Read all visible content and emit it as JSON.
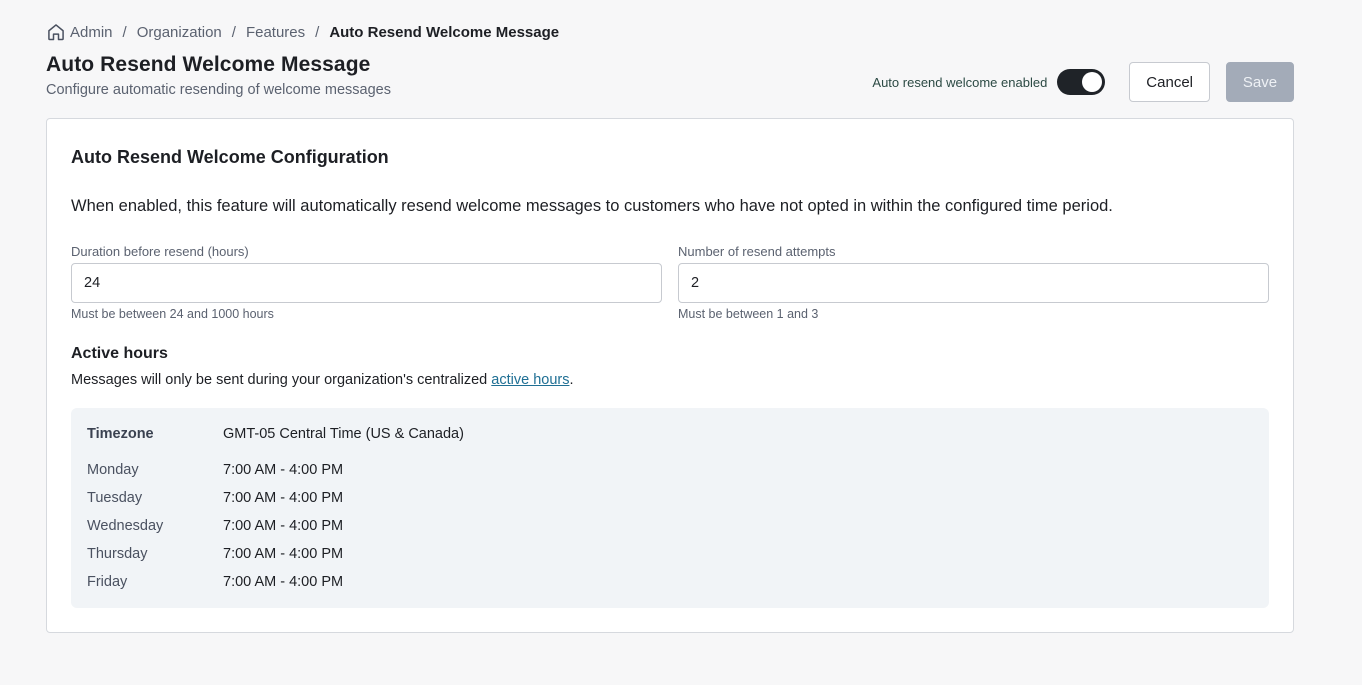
{
  "breadcrumb": {
    "items": [
      "Admin",
      "Organization",
      "Features",
      "Auto Resend Welcome Message"
    ],
    "separator": "/"
  },
  "page": {
    "title": "Auto Resend Welcome Message",
    "subtitle": "Configure automatic resending of welcome messages"
  },
  "header_actions": {
    "toggle_label": "Auto resend welcome enabled",
    "toggle_on": true,
    "cancel_label": "Cancel",
    "save_label": "Save"
  },
  "card": {
    "title": "Auto Resend Welcome Configuration",
    "description": "When enabled, this feature will automatically resend welcome messages to customers who have not opted in within the configured time period."
  },
  "fields": {
    "duration": {
      "label": "Duration before resend (hours)",
      "value": "24",
      "hint": "Must be between 24 and 1000 hours"
    },
    "attempts": {
      "label": "Number of resend attempts",
      "value": "2",
      "hint": "Must be between 1 and 3"
    }
  },
  "active_hours": {
    "title": "Active hours",
    "desc_prefix": "Messages will only be sent during your organization's centralized ",
    "link_text": "active hours",
    "desc_suffix": ".",
    "timezone_label": "Timezone",
    "timezone_value": "GMT-05 Central Time (US & Canada)",
    "days": [
      {
        "day": "Monday",
        "hours": "7:00 AM - 4:00 PM"
      },
      {
        "day": "Tuesday",
        "hours": "7:00 AM - 4:00 PM"
      },
      {
        "day": "Wednesday",
        "hours": "7:00 AM - 4:00 PM"
      },
      {
        "day": "Thursday",
        "hours": "7:00 AM - 4:00 PM"
      },
      {
        "day": "Friday",
        "hours": "7:00 AM - 4:00 PM"
      }
    ]
  },
  "colors": {
    "page_background": "#f7f7f8",
    "toggle_on": "#1f2328",
    "save_disabled": "#a3abb8",
    "link": "#1f6f94",
    "hours_panel": "#f1f4f7"
  },
  "icons": {
    "breadcrumb_home": "home-icon"
  }
}
